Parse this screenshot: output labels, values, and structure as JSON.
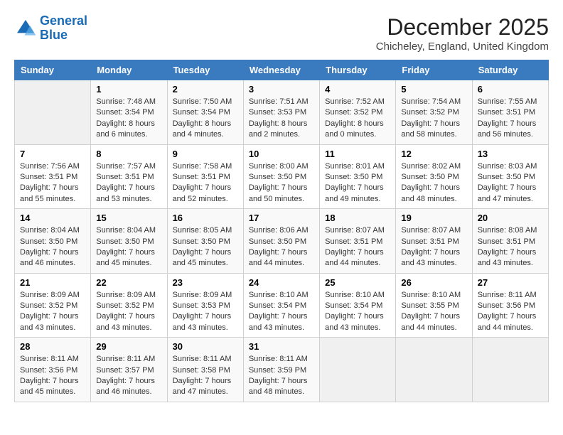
{
  "header": {
    "logo_line1": "General",
    "logo_line2": "Blue",
    "month_title": "December 2025",
    "location": "Chicheley, England, United Kingdom"
  },
  "days_of_week": [
    "Sunday",
    "Monday",
    "Tuesday",
    "Wednesday",
    "Thursday",
    "Friday",
    "Saturday"
  ],
  "weeks": [
    [
      {
        "day": "",
        "info": ""
      },
      {
        "day": "1",
        "info": "Sunrise: 7:48 AM\nSunset: 3:54 PM\nDaylight: 8 hours\nand 6 minutes."
      },
      {
        "day": "2",
        "info": "Sunrise: 7:50 AM\nSunset: 3:54 PM\nDaylight: 8 hours\nand 4 minutes."
      },
      {
        "day": "3",
        "info": "Sunrise: 7:51 AM\nSunset: 3:53 PM\nDaylight: 8 hours\nand 2 minutes."
      },
      {
        "day": "4",
        "info": "Sunrise: 7:52 AM\nSunset: 3:52 PM\nDaylight: 8 hours\nand 0 minutes."
      },
      {
        "day": "5",
        "info": "Sunrise: 7:54 AM\nSunset: 3:52 PM\nDaylight: 7 hours\nand 58 minutes."
      },
      {
        "day": "6",
        "info": "Sunrise: 7:55 AM\nSunset: 3:51 PM\nDaylight: 7 hours\nand 56 minutes."
      }
    ],
    [
      {
        "day": "7",
        "info": "Sunrise: 7:56 AM\nSunset: 3:51 PM\nDaylight: 7 hours\nand 55 minutes."
      },
      {
        "day": "8",
        "info": "Sunrise: 7:57 AM\nSunset: 3:51 PM\nDaylight: 7 hours\nand 53 minutes."
      },
      {
        "day": "9",
        "info": "Sunrise: 7:58 AM\nSunset: 3:51 PM\nDaylight: 7 hours\nand 52 minutes."
      },
      {
        "day": "10",
        "info": "Sunrise: 8:00 AM\nSunset: 3:50 PM\nDaylight: 7 hours\nand 50 minutes."
      },
      {
        "day": "11",
        "info": "Sunrise: 8:01 AM\nSunset: 3:50 PM\nDaylight: 7 hours\nand 49 minutes."
      },
      {
        "day": "12",
        "info": "Sunrise: 8:02 AM\nSunset: 3:50 PM\nDaylight: 7 hours\nand 48 minutes."
      },
      {
        "day": "13",
        "info": "Sunrise: 8:03 AM\nSunset: 3:50 PM\nDaylight: 7 hours\nand 47 minutes."
      }
    ],
    [
      {
        "day": "14",
        "info": "Sunrise: 8:04 AM\nSunset: 3:50 PM\nDaylight: 7 hours\nand 46 minutes."
      },
      {
        "day": "15",
        "info": "Sunrise: 8:04 AM\nSunset: 3:50 PM\nDaylight: 7 hours\nand 45 minutes."
      },
      {
        "day": "16",
        "info": "Sunrise: 8:05 AM\nSunset: 3:50 PM\nDaylight: 7 hours\nand 45 minutes."
      },
      {
        "day": "17",
        "info": "Sunrise: 8:06 AM\nSunset: 3:50 PM\nDaylight: 7 hours\nand 44 minutes."
      },
      {
        "day": "18",
        "info": "Sunrise: 8:07 AM\nSunset: 3:51 PM\nDaylight: 7 hours\nand 44 minutes."
      },
      {
        "day": "19",
        "info": "Sunrise: 8:07 AM\nSunset: 3:51 PM\nDaylight: 7 hours\nand 43 minutes."
      },
      {
        "day": "20",
        "info": "Sunrise: 8:08 AM\nSunset: 3:51 PM\nDaylight: 7 hours\nand 43 minutes."
      }
    ],
    [
      {
        "day": "21",
        "info": "Sunrise: 8:09 AM\nSunset: 3:52 PM\nDaylight: 7 hours\nand 43 minutes."
      },
      {
        "day": "22",
        "info": "Sunrise: 8:09 AM\nSunset: 3:52 PM\nDaylight: 7 hours\nand 43 minutes."
      },
      {
        "day": "23",
        "info": "Sunrise: 8:09 AM\nSunset: 3:53 PM\nDaylight: 7 hours\nand 43 minutes."
      },
      {
        "day": "24",
        "info": "Sunrise: 8:10 AM\nSunset: 3:54 PM\nDaylight: 7 hours\nand 43 minutes."
      },
      {
        "day": "25",
        "info": "Sunrise: 8:10 AM\nSunset: 3:54 PM\nDaylight: 7 hours\nand 43 minutes."
      },
      {
        "day": "26",
        "info": "Sunrise: 8:10 AM\nSunset: 3:55 PM\nDaylight: 7 hours\nand 44 minutes."
      },
      {
        "day": "27",
        "info": "Sunrise: 8:11 AM\nSunset: 3:56 PM\nDaylight: 7 hours\nand 44 minutes."
      }
    ],
    [
      {
        "day": "28",
        "info": "Sunrise: 8:11 AM\nSunset: 3:56 PM\nDaylight: 7 hours\nand 45 minutes."
      },
      {
        "day": "29",
        "info": "Sunrise: 8:11 AM\nSunset: 3:57 PM\nDaylight: 7 hours\nand 46 minutes."
      },
      {
        "day": "30",
        "info": "Sunrise: 8:11 AM\nSunset: 3:58 PM\nDaylight: 7 hours\nand 47 minutes."
      },
      {
        "day": "31",
        "info": "Sunrise: 8:11 AM\nSunset: 3:59 PM\nDaylight: 7 hours\nand 48 minutes."
      },
      {
        "day": "",
        "info": ""
      },
      {
        "day": "",
        "info": ""
      },
      {
        "day": "",
        "info": ""
      }
    ]
  ]
}
